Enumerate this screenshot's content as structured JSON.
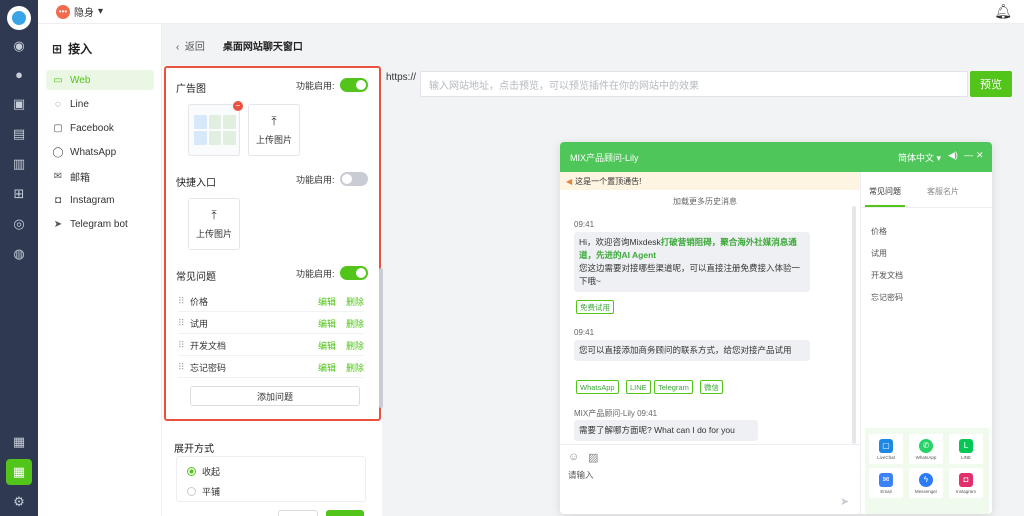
{
  "topbar": {
    "status": "隐身",
    "status_caret": "▾"
  },
  "sidenav": {
    "title": "接入",
    "items": [
      {
        "label": "Web",
        "icon": "web-icon"
      },
      {
        "label": "Line",
        "icon": "line-icon"
      },
      {
        "label": "Facebook",
        "icon": "facebook-icon"
      },
      {
        "label": "WhatsApp",
        "icon": "whatsapp-icon"
      },
      {
        "label": "邮箱",
        "icon": "mail-icon"
      },
      {
        "label": "Instagram",
        "icon": "instagram-icon"
      },
      {
        "label": "Telegram bot",
        "icon": "telegram-icon"
      }
    ]
  },
  "breadcrumb": {
    "back": "返回",
    "title": "桌面网站聊天窗口"
  },
  "settings": {
    "banner": {
      "label": "广告图",
      "toggle_label": "功能启用:",
      "enabled": true,
      "upload_label": "上传图片"
    },
    "quick_entry": {
      "label": "快捷入口",
      "toggle_label": "功能启用:",
      "enabled": false,
      "upload_label": "上传图片"
    },
    "faq": {
      "label": "常见问题",
      "toggle_label": "功能启用:",
      "enabled": true,
      "edit_label": "编辑",
      "delete_label": "删除",
      "items": [
        "价格",
        "试用",
        "开发文档",
        "忘记密码"
      ],
      "add_label": "添加问题"
    },
    "expand": {
      "label": "展开方式",
      "options": [
        "收起",
        "平铺"
      ],
      "selected": "收起"
    },
    "cancel_label": "取 消",
    "save_label": "保 存"
  },
  "preview": {
    "url_prefix": "https://",
    "url_placeholder": "输入网站地址，点击预览，可以预览插件在你的网站中的效果",
    "preview_label": "预览"
  },
  "widget": {
    "title": "MIX产品顾问-Lily",
    "language": "简体中文",
    "language_caret": "▾",
    "notice": "这是一个置顶通告!",
    "load_more": "加载更多历史消息",
    "messages": [
      {
        "time": "09:41",
        "text_pre": "Hi，欢迎咨询Mixdesk",
        "highlight": "打破营销阻碍，聚合海外社媒消息通道，先进的AI Agent",
        "text_post": "您这边需要对接哪些渠道呢，可以直接注册免费接入体验一下哦~"
      },
      {
        "chips": [
          "免费试用"
        ]
      },
      {
        "time": "09:41",
        "text": "您可以直接添加商务顾问的联系方式，给您对接产品试用"
      },
      {
        "chips": [
          "WhatsApp",
          "LINE",
          "Telegram",
          "微信"
        ]
      },
      {
        "time": "MIX产品顾问-Lily 09:41",
        "text": "需要了解哪方面呢? What can I do for you"
      }
    ],
    "input_placeholder": "请输入",
    "side_tabs": [
      "常见问题",
      "客服名片"
    ],
    "faq": [
      "价格",
      "试用",
      "开发文档",
      "忘记密码"
    ],
    "contacts": [
      "LiveChat",
      "WhatsApp",
      "LINE",
      "Email",
      "Messenger",
      "Instagram"
    ]
  },
  "colors": {
    "accent": "#52c41a",
    "rail": "#2f3a52",
    "highlight_border": "#e8523f",
    "widget_header": "#4fc65a"
  }
}
